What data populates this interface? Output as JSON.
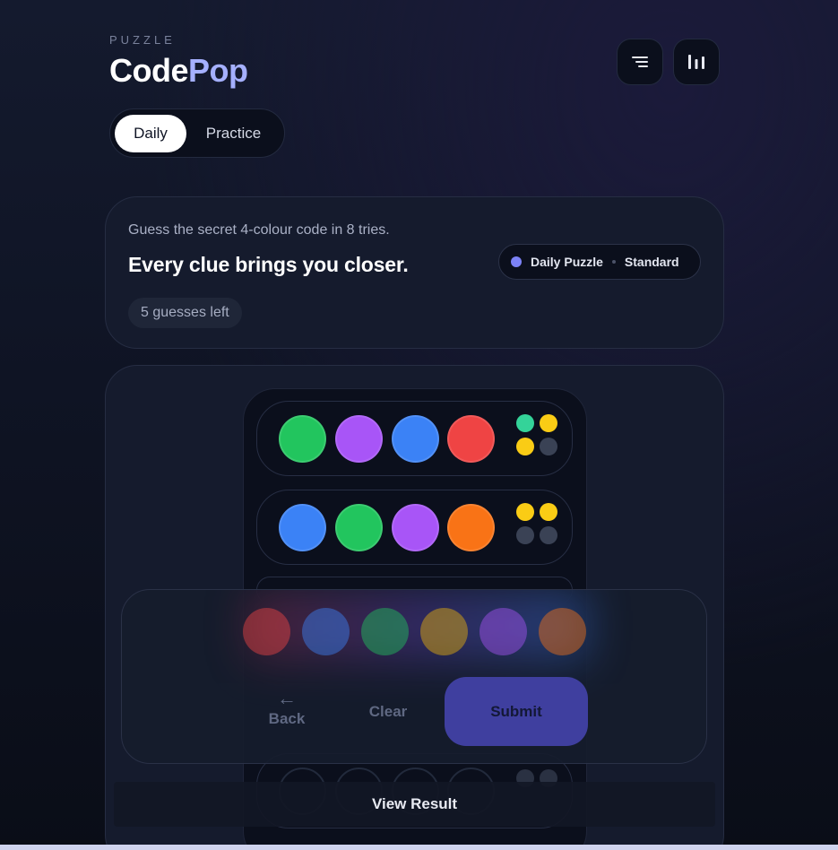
{
  "header": {
    "eyebrow": "PUZZLE",
    "brand_part1": "Code",
    "brand_part2": "Pop",
    "menu_icon": "menu-icon",
    "stats_icon": "bar-chart-icon"
  },
  "tabs": [
    {
      "label": "Daily",
      "active": true
    },
    {
      "label": "Practice",
      "active": false
    }
  ],
  "info": {
    "subtitle": "Guess the secret 4-colour code in 8 tries.",
    "headline": "Every clue brings you closer.",
    "guesses_left": "5 guesses left",
    "mode_label": "Daily Puzzle",
    "difficulty": "Standard"
  },
  "colors": {
    "green": "#22c55e",
    "purple": "#a855f7",
    "blue": "#3b82f6",
    "red": "#ef4444",
    "orange": "#f97316",
    "yellow": "#eab308",
    "hint_exact": "#34d399",
    "hint_color": "#facc15",
    "hint_empty": "#3a4255"
  },
  "guesses": [
    {
      "pegs": [
        "green",
        "purple",
        "blue",
        "red"
      ],
      "hints": [
        "exact",
        "color",
        "color",
        "empty"
      ]
    },
    {
      "pegs": [
        "blue",
        "green",
        "purple",
        "orange"
      ],
      "hints": [
        "color",
        "color",
        "empty",
        "empty"
      ]
    }
  ],
  "palette": [
    "red",
    "blue",
    "green",
    "yellow",
    "purple",
    "orange"
  ],
  "controls": {
    "back_arrow": "←",
    "back": "Back",
    "clear": "Clear",
    "submit": "Submit"
  },
  "view_result": "View Result"
}
